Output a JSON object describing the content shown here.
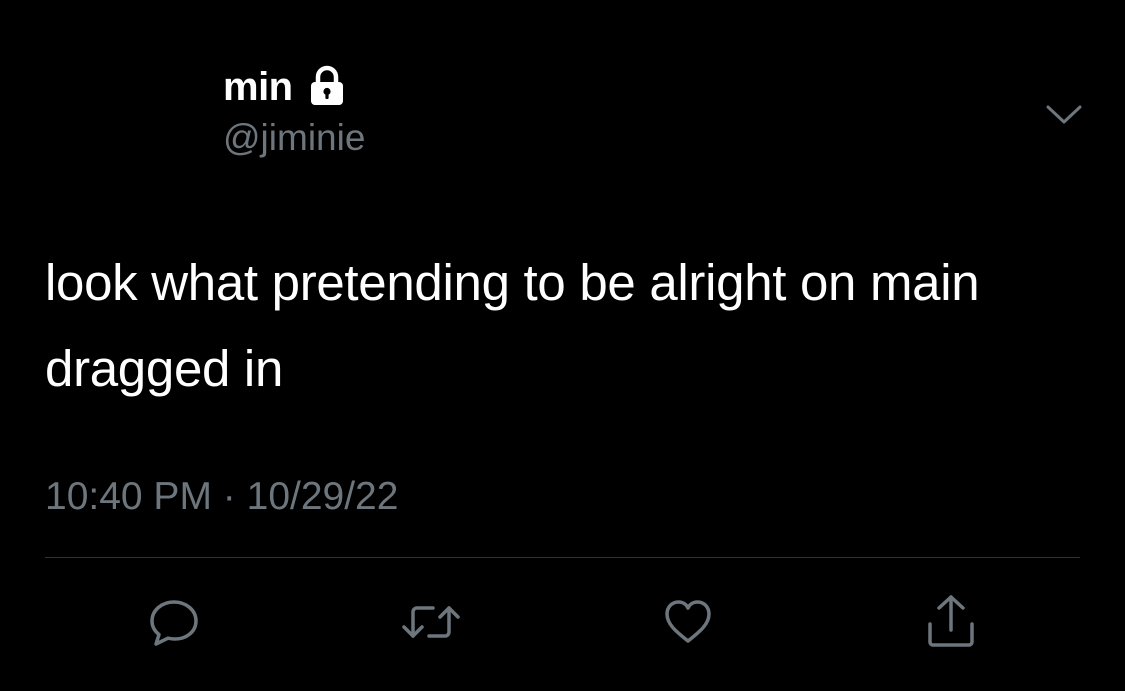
{
  "tweet": {
    "author": {
      "display_name": "min",
      "handle": "@jiminie",
      "protected_icon": "lock-icon"
    },
    "more_icon": "chevron-down-icon",
    "text": "look what pretending to be alright on main dragged in",
    "time": "10:40 PM",
    "separator": "·",
    "date": "10/29/22",
    "actions": [
      {
        "name": "reply",
        "icon": "reply-icon"
      },
      {
        "name": "retweet",
        "icon": "retweet-icon"
      },
      {
        "name": "like",
        "icon": "heart-icon"
      },
      {
        "name": "share",
        "icon": "share-icon"
      }
    ]
  },
  "colors": {
    "background": "#000000",
    "text": "#ffffff",
    "secondary": "#6e767d",
    "divider": "#2f3336"
  }
}
